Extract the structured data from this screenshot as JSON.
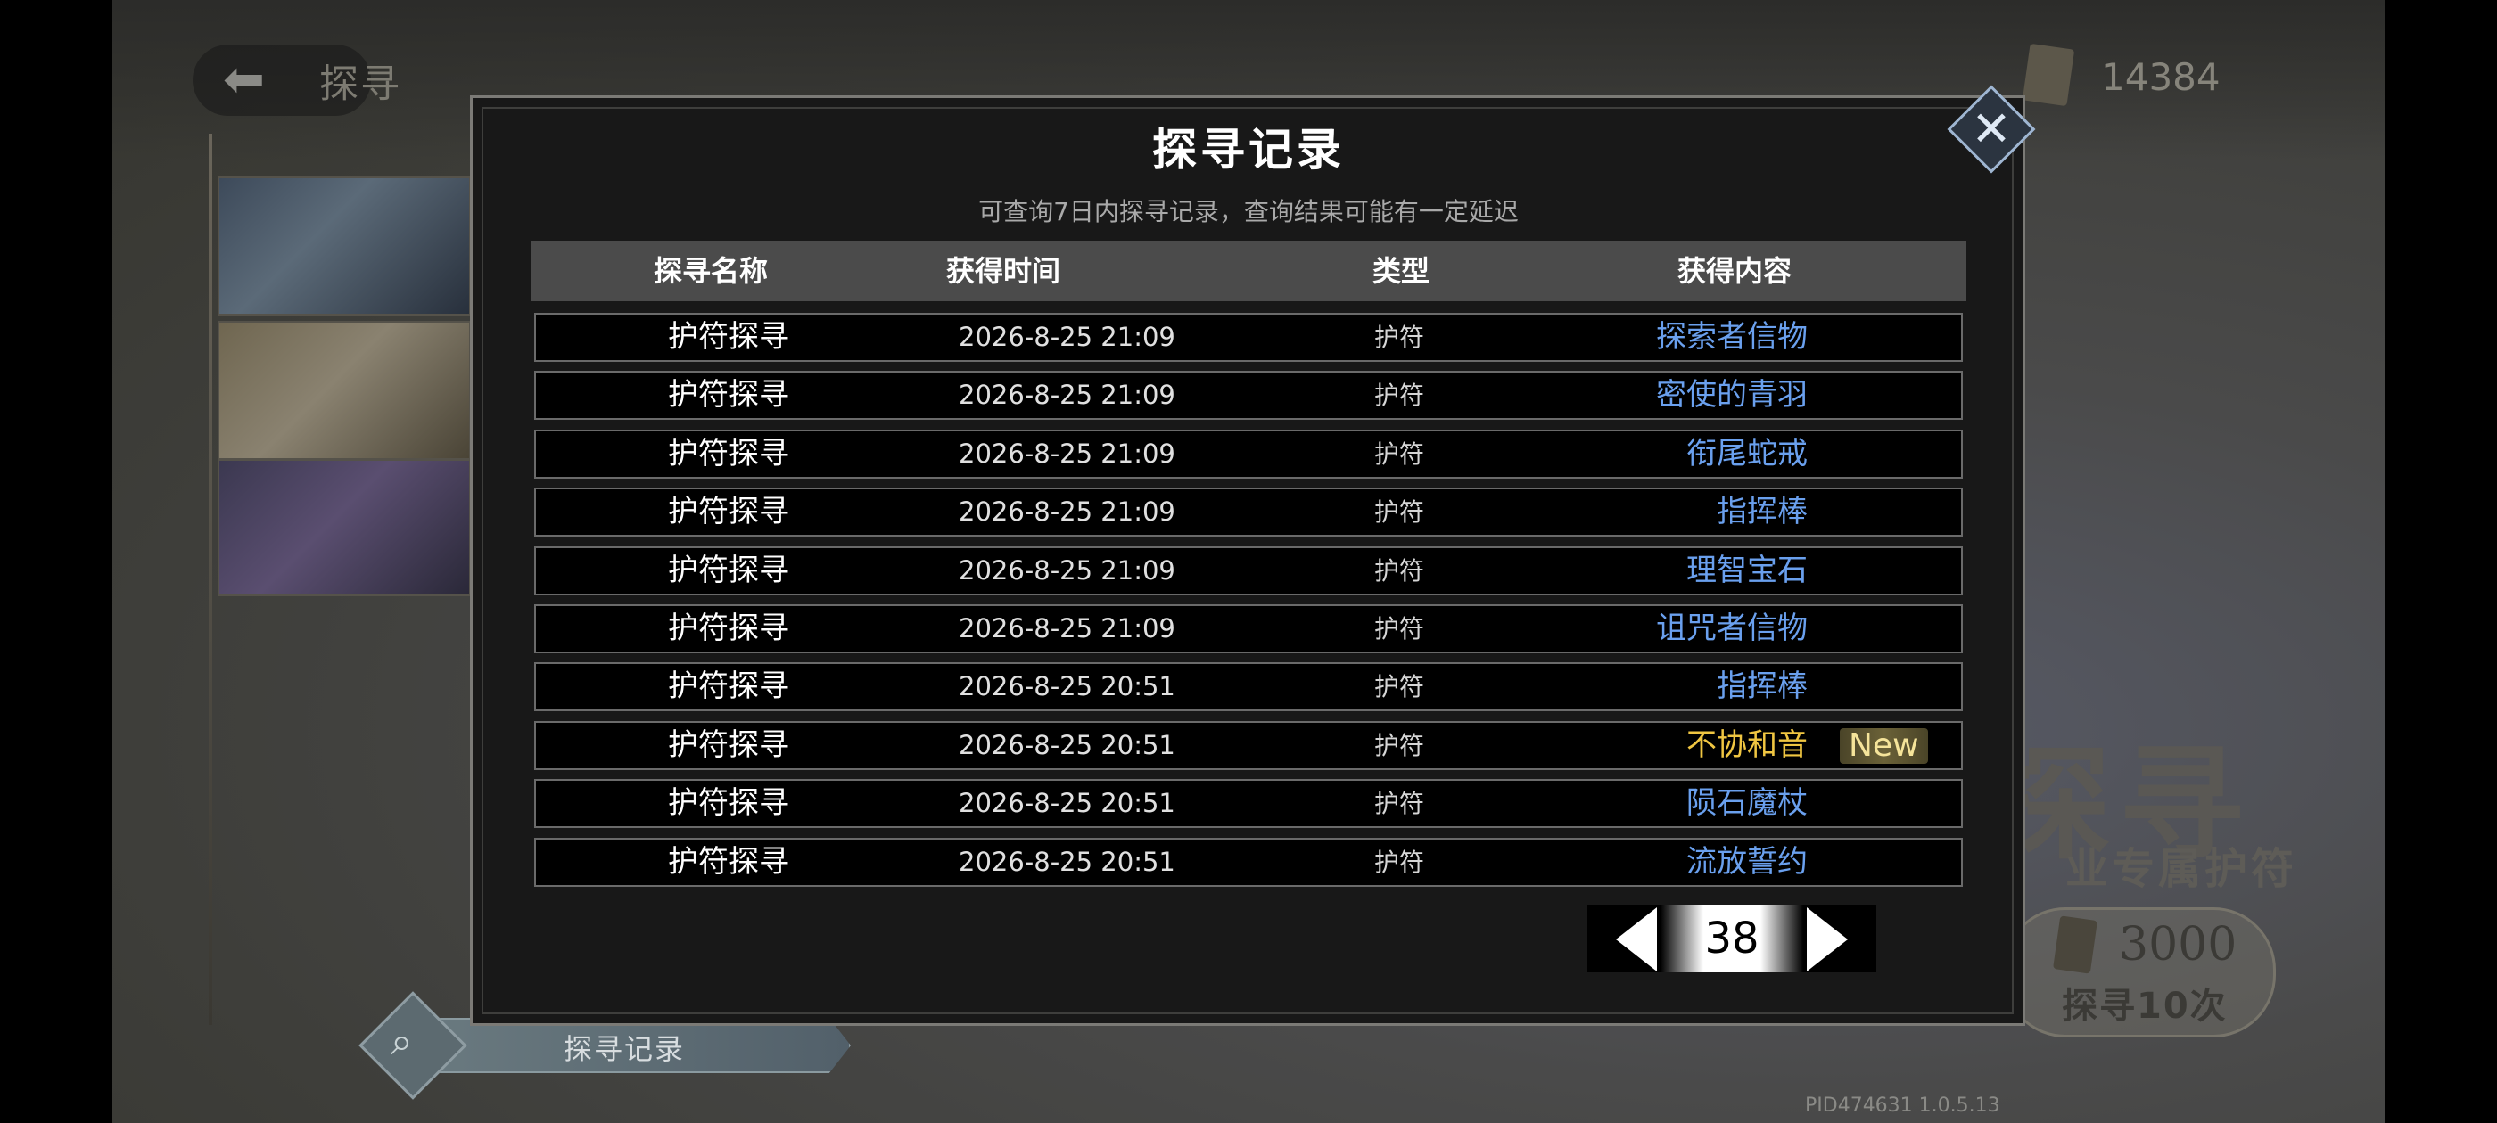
{
  "background": {
    "title": "探寻",
    "currency": "14384",
    "big_title": "探寻",
    "big_subtitle": "业专属护符",
    "cost_value": "3000",
    "cost_label": "探寻10次",
    "record_tab_label": "探寻记录",
    "version": "PID474631  1.0.5.13"
  },
  "modal": {
    "title": "探寻记录",
    "subtitle": "可查询7日内探寻记录，查询结果可能有一定延迟",
    "columns": [
      "探寻名称",
      "获得时间",
      "类型",
      "获得内容"
    ],
    "rows": [
      {
        "name": "护符探寻",
        "time": "2026-8-25 21:09",
        "type": "护符",
        "content": "探索者信物"
      },
      {
        "name": "护符探寻",
        "time": "2026-8-25 21:09",
        "type": "护符",
        "content": "密使的青羽"
      },
      {
        "name": "护符探寻",
        "time": "2026-8-25 21:09",
        "type": "护符",
        "content": "衔尾蛇戒"
      },
      {
        "name": "护符探寻",
        "time": "2026-8-25 21:09",
        "type": "护符",
        "content": "指挥棒"
      },
      {
        "name": "护符探寻",
        "time": "2026-8-25 21:09",
        "type": "护符",
        "content": "理智宝石"
      },
      {
        "name": "护符探寻",
        "time": "2026-8-25 21:09",
        "type": "护符",
        "content": "诅咒者信物"
      },
      {
        "name": "护符探寻",
        "time": "2026-8-25 20:51",
        "type": "护符",
        "content": "指挥棒"
      },
      {
        "name": "护符探寻",
        "time": "2026-8-25 20:51",
        "type": "护符",
        "content": "不协和音",
        "badge": "New"
      },
      {
        "name": "护符探寻",
        "time": "2026-8-25 20:51",
        "type": "护符",
        "content": "陨石魔杖"
      },
      {
        "name": "护符探寻",
        "time": "2026-8-25 20:51",
        "type": "护符",
        "content": "流放誓约"
      }
    ],
    "page": "38"
  },
  "colors": {
    "content_blue": "#6aa0ee",
    "content_gold": "#f0c642"
  },
  "icons": [
    "back-arrow-icon",
    "currency-icon",
    "close-icon",
    "search-icon",
    "prev-page-icon",
    "next-page-icon"
  ]
}
